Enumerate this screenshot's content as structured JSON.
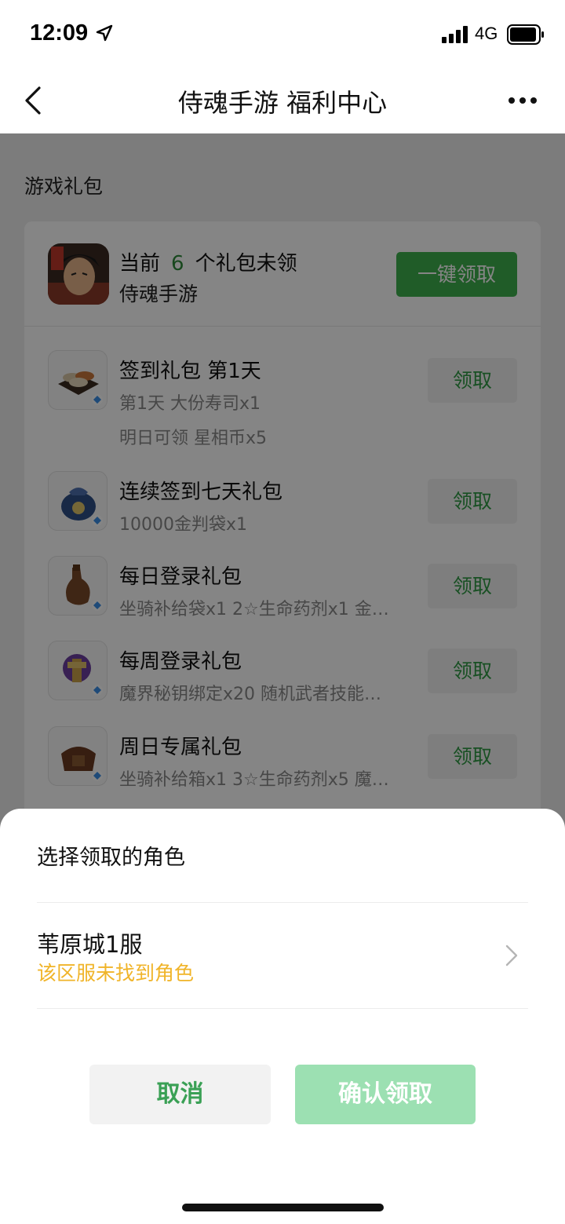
{
  "status_bar": {
    "time": "12:09",
    "network": "4G"
  },
  "nav": {
    "title": "侍魂手游 福利中心"
  },
  "section_title": "游戏礼包",
  "summary": {
    "prefix": "当前",
    "count": "6",
    "suffix": "个礼包未领",
    "game_name": "侍魂手游",
    "claim_all_label": "一键领取"
  },
  "gifts": [
    {
      "name": "签到礼包 第1天",
      "desc": "第1天 大份寿司x1",
      "extra": "明日可领 星相币x5",
      "button": "领取"
    },
    {
      "name": "连续签到七天礼包",
      "desc": "10000金判袋x1",
      "button": "领取"
    },
    {
      "name": "每日登录礼包",
      "desc": "坐骑补给袋x1 2☆生命药剂x1 金…",
      "button": "领取"
    },
    {
      "name": "每周登录礼包",
      "desc": "魔界秘钥绑定x20 随机武者技能…",
      "button": "领取"
    },
    {
      "name": "周日专属礼包",
      "desc": "坐骑补给箱x1 3☆生命药剂x5 魔…",
      "button": "领取"
    }
  ],
  "sheet": {
    "title": "选择领取的角色",
    "server": "苇原城1服",
    "server_status": "该区服未找到角色",
    "cancel_label": "取消",
    "confirm_label": "确认领取"
  },
  "colors": {
    "accent_green": "#3fb04e",
    "warning_yellow": "#f0b429",
    "confirm_disabled": "#9ce0b2"
  }
}
